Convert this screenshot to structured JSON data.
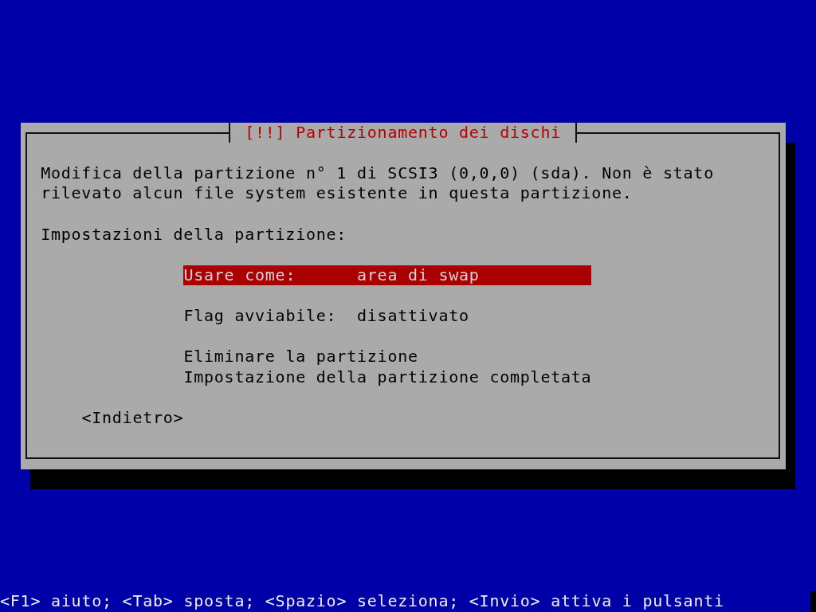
{
  "dialog": {
    "title": "[!!] Partizionamento dei dischi",
    "message": "Modifica della partizione n° 1 di SCSI3 (0,0,0) (sda). Non è stato rilevato alcun file system esistente in questa partizione.",
    "prompt": "Impostazioni della partizione:",
    "menu_groups": [
      [
        {
          "label": "Usare come:",
          "value": "area di swap",
          "selected": true
        }
      ],
      [
        {
          "label": "Flag avviabile:",
          "value": "disattivato",
          "selected": false
        }
      ],
      [
        {
          "label": "Eliminare la partizione",
          "selected": false
        },
        {
          "label": "Impostazione della partizione completata",
          "selected": false
        }
      ]
    ],
    "buttons": [
      {
        "label": "<Indietro>",
        "selected": false
      }
    ]
  },
  "status_bar": "<F1> aiuto; <Tab> sposta; <Spazio> seleziona; <Invio> attiva i pulsanti"
}
